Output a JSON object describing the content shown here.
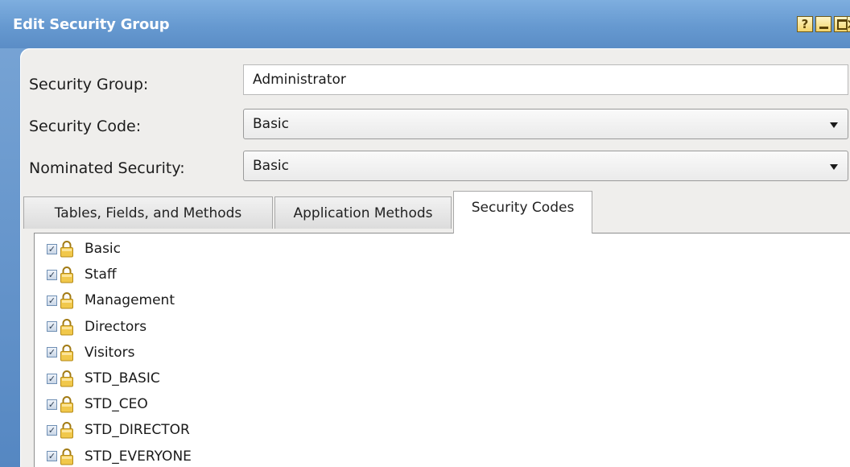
{
  "window": {
    "title": "Edit Security Group",
    "help_label": "?"
  },
  "form": {
    "security_group": {
      "label": "Security Group:",
      "value": "Administrator"
    },
    "security_code": {
      "label": "Security Code:",
      "value": "Basic"
    },
    "nominated_security": {
      "label": "Nominated Security:",
      "value": "Basic"
    }
  },
  "tabs": [
    {
      "label": "Tables, Fields, and Methods",
      "active": false
    },
    {
      "label": "Application Methods",
      "active": false
    },
    {
      "label": "Security Codes",
      "active": true
    }
  ],
  "security_codes": [
    {
      "label": "Basic",
      "checked": true
    },
    {
      "label": "Staff",
      "checked": true
    },
    {
      "label": "Management",
      "checked": true
    },
    {
      "label": "Directors",
      "checked": true
    },
    {
      "label": "Visitors",
      "checked": true
    },
    {
      "label": "STD_BASIC",
      "checked": true
    },
    {
      "label": "STD_CEO",
      "checked": true
    },
    {
      "label": "STD_DIRECTOR",
      "checked": true
    },
    {
      "label": "STD_EVERYONE",
      "checked": true
    }
  ],
  "icons": {
    "check": "✓",
    "lock": "lock-icon"
  },
  "colors": {
    "titlebar": "#6699d0",
    "panel": "#efeeec",
    "lock_gold": "#e8b93a"
  }
}
